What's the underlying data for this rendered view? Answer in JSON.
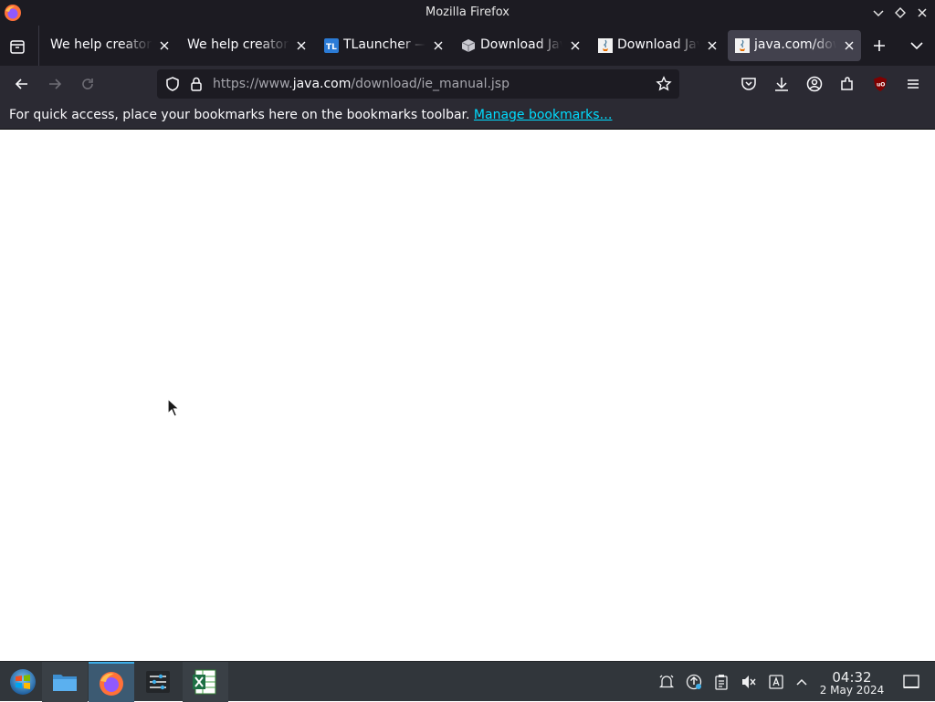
{
  "window": {
    "title": "Mozilla Firefox"
  },
  "tabs": [
    {
      "label": "We help creators",
      "favicon": "none",
      "active": false
    },
    {
      "label": "We help creators",
      "favicon": "none",
      "active": false
    },
    {
      "label": "TLauncher — ",
      "favicon": "tlauncher-icon",
      "active": false
    },
    {
      "label": "Download Jav",
      "favicon": "package-icon",
      "active": false
    },
    {
      "label": "Download Jav",
      "favicon": "java-icon",
      "active": false
    },
    {
      "label": "java.com/dow",
      "favicon": "java-icon",
      "active": true
    }
  ],
  "navbar": {
    "url_prefix": "https://www.",
    "url_host": "java.com",
    "url_path": "/download/ie_manual.jsp"
  },
  "bookmarks_bar": {
    "message": "For quick access, place your bookmarks here on the bookmarks toolbar. ",
    "link": "Manage bookmarks…"
  },
  "taskbar": {
    "apps": [
      "start-menu",
      "file-manager",
      "firefox",
      "system-settings",
      "spreadsheet"
    ],
    "time": "04:32",
    "date": "2 May 2024"
  },
  "colors": {
    "chrome_dark": "#1c1b22",
    "toolbar": "#2b2a33",
    "active_tab": "#42414d",
    "link": "#00ddff",
    "taskbar": "#31363b"
  }
}
